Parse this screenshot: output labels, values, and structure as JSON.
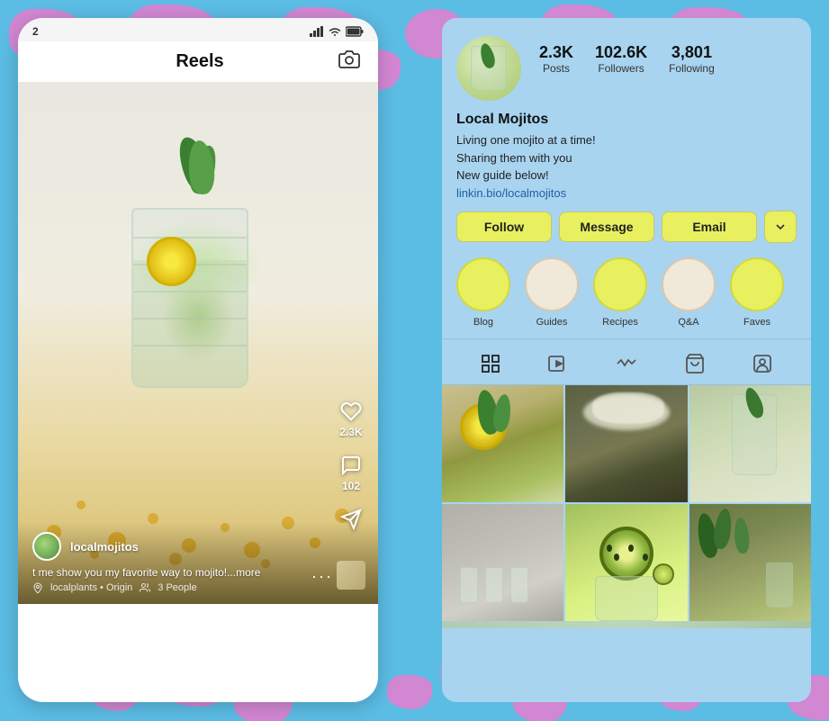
{
  "background": {
    "color": "#5bbce4",
    "spot_color": "#e87ecf"
  },
  "left_panel": {
    "status_bar": {
      "number": "2",
      "signal_icon": "signal-bars-icon",
      "wifi_icon": "wifi-icon",
      "battery_icon": "battery-icon"
    },
    "header": {
      "title": "Reels",
      "camera_icon": "camera-icon"
    },
    "reel": {
      "likes": "2.3K",
      "comments": "102",
      "share_icon": "share-icon",
      "username": "localmojitos",
      "caption": "t me show you my favorite way to mojito!...more",
      "tag1": "localplants • Origin",
      "tag2": "3 People"
    }
  },
  "right_panel": {
    "profile": {
      "name": "Local Mojitos",
      "bio_line1": "Living one mojito at a time!",
      "bio_line2": "Sharing them with you",
      "bio_line3": "New guide below!",
      "link": "linkin.bio/localmojitos"
    },
    "stats": {
      "posts_count": "2.3K",
      "posts_label": "Posts",
      "followers_count": "102.6K",
      "followers_label": "Followers",
      "following_count": "3,801",
      "following_label": "Following"
    },
    "actions": {
      "follow_label": "Follow",
      "message_label": "Message",
      "email_label": "Email",
      "dropdown_icon": "chevron-down-icon"
    },
    "highlights": [
      {
        "label": "Blog",
        "color": "yellow"
      },
      {
        "label": "Guides",
        "color": "cream"
      },
      {
        "label": "Recipes",
        "color": "yellow"
      },
      {
        "label": "Q&A",
        "color": "cream"
      },
      {
        "label": "Faves",
        "color": "yellow"
      }
    ],
    "tabs": [
      {
        "icon": "grid-icon",
        "active": true
      },
      {
        "icon": "video-icon",
        "active": false
      },
      {
        "icon": "chart-icon",
        "active": false
      },
      {
        "icon": "bag-icon",
        "active": false
      },
      {
        "icon": "person-tag-icon",
        "active": false
      }
    ],
    "grid": [
      {
        "type": "mojito-lemon",
        "alt": "mojito with lemon"
      },
      {
        "type": "salad",
        "alt": "food dish"
      },
      {
        "type": "glass-mint",
        "alt": "glass with mint"
      },
      {
        "type": "shots",
        "alt": "shot glasses"
      },
      {
        "type": "kiwi-drink",
        "alt": "kiwi cocktail"
      },
      {
        "type": "herbs",
        "alt": "herbs and drinks"
      }
    ]
  }
}
